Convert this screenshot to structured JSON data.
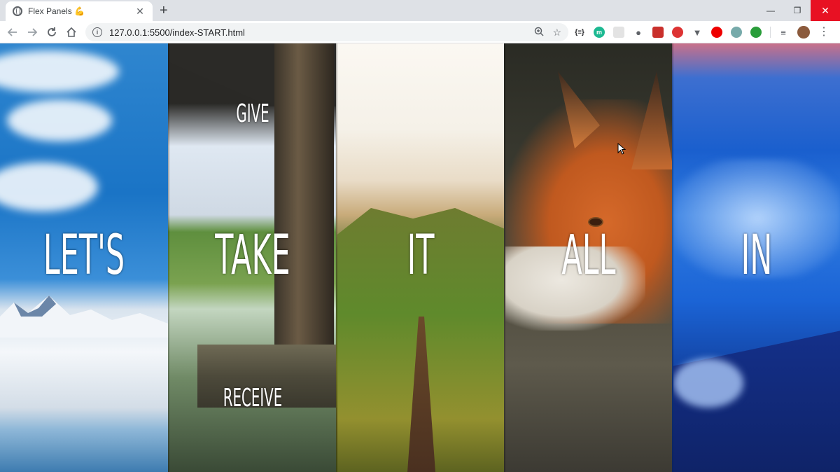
{
  "browser": {
    "tab_title": "Flex Panels 💪",
    "tab_close": "✕",
    "new_tab": "+",
    "url": "127.0.0.1:5500/index-START.html",
    "window_controls": {
      "minimize": "—",
      "restore": "❐",
      "close": "✕"
    }
  },
  "panels": [
    {
      "top": "",
      "main": "LET'S",
      "bottom": ""
    },
    {
      "top": "GIVE",
      "main": "TAKE",
      "bottom": "RECEIVE"
    },
    {
      "top": "",
      "main": "IT",
      "bottom": ""
    },
    {
      "top": "",
      "main": "ALL",
      "bottom": ""
    },
    {
      "top": "",
      "main": "IN",
      "bottom": ""
    }
  ],
  "icons": {
    "back": "back-arrow-icon",
    "forward": "forward-arrow-icon",
    "reload": "reload-icon",
    "home": "home-icon",
    "zoom": "zoom-icon",
    "bookmark": "star-icon"
  },
  "colors": {
    "tabstrip": "#dee1e6",
    "close_button": "#e81123"
  }
}
